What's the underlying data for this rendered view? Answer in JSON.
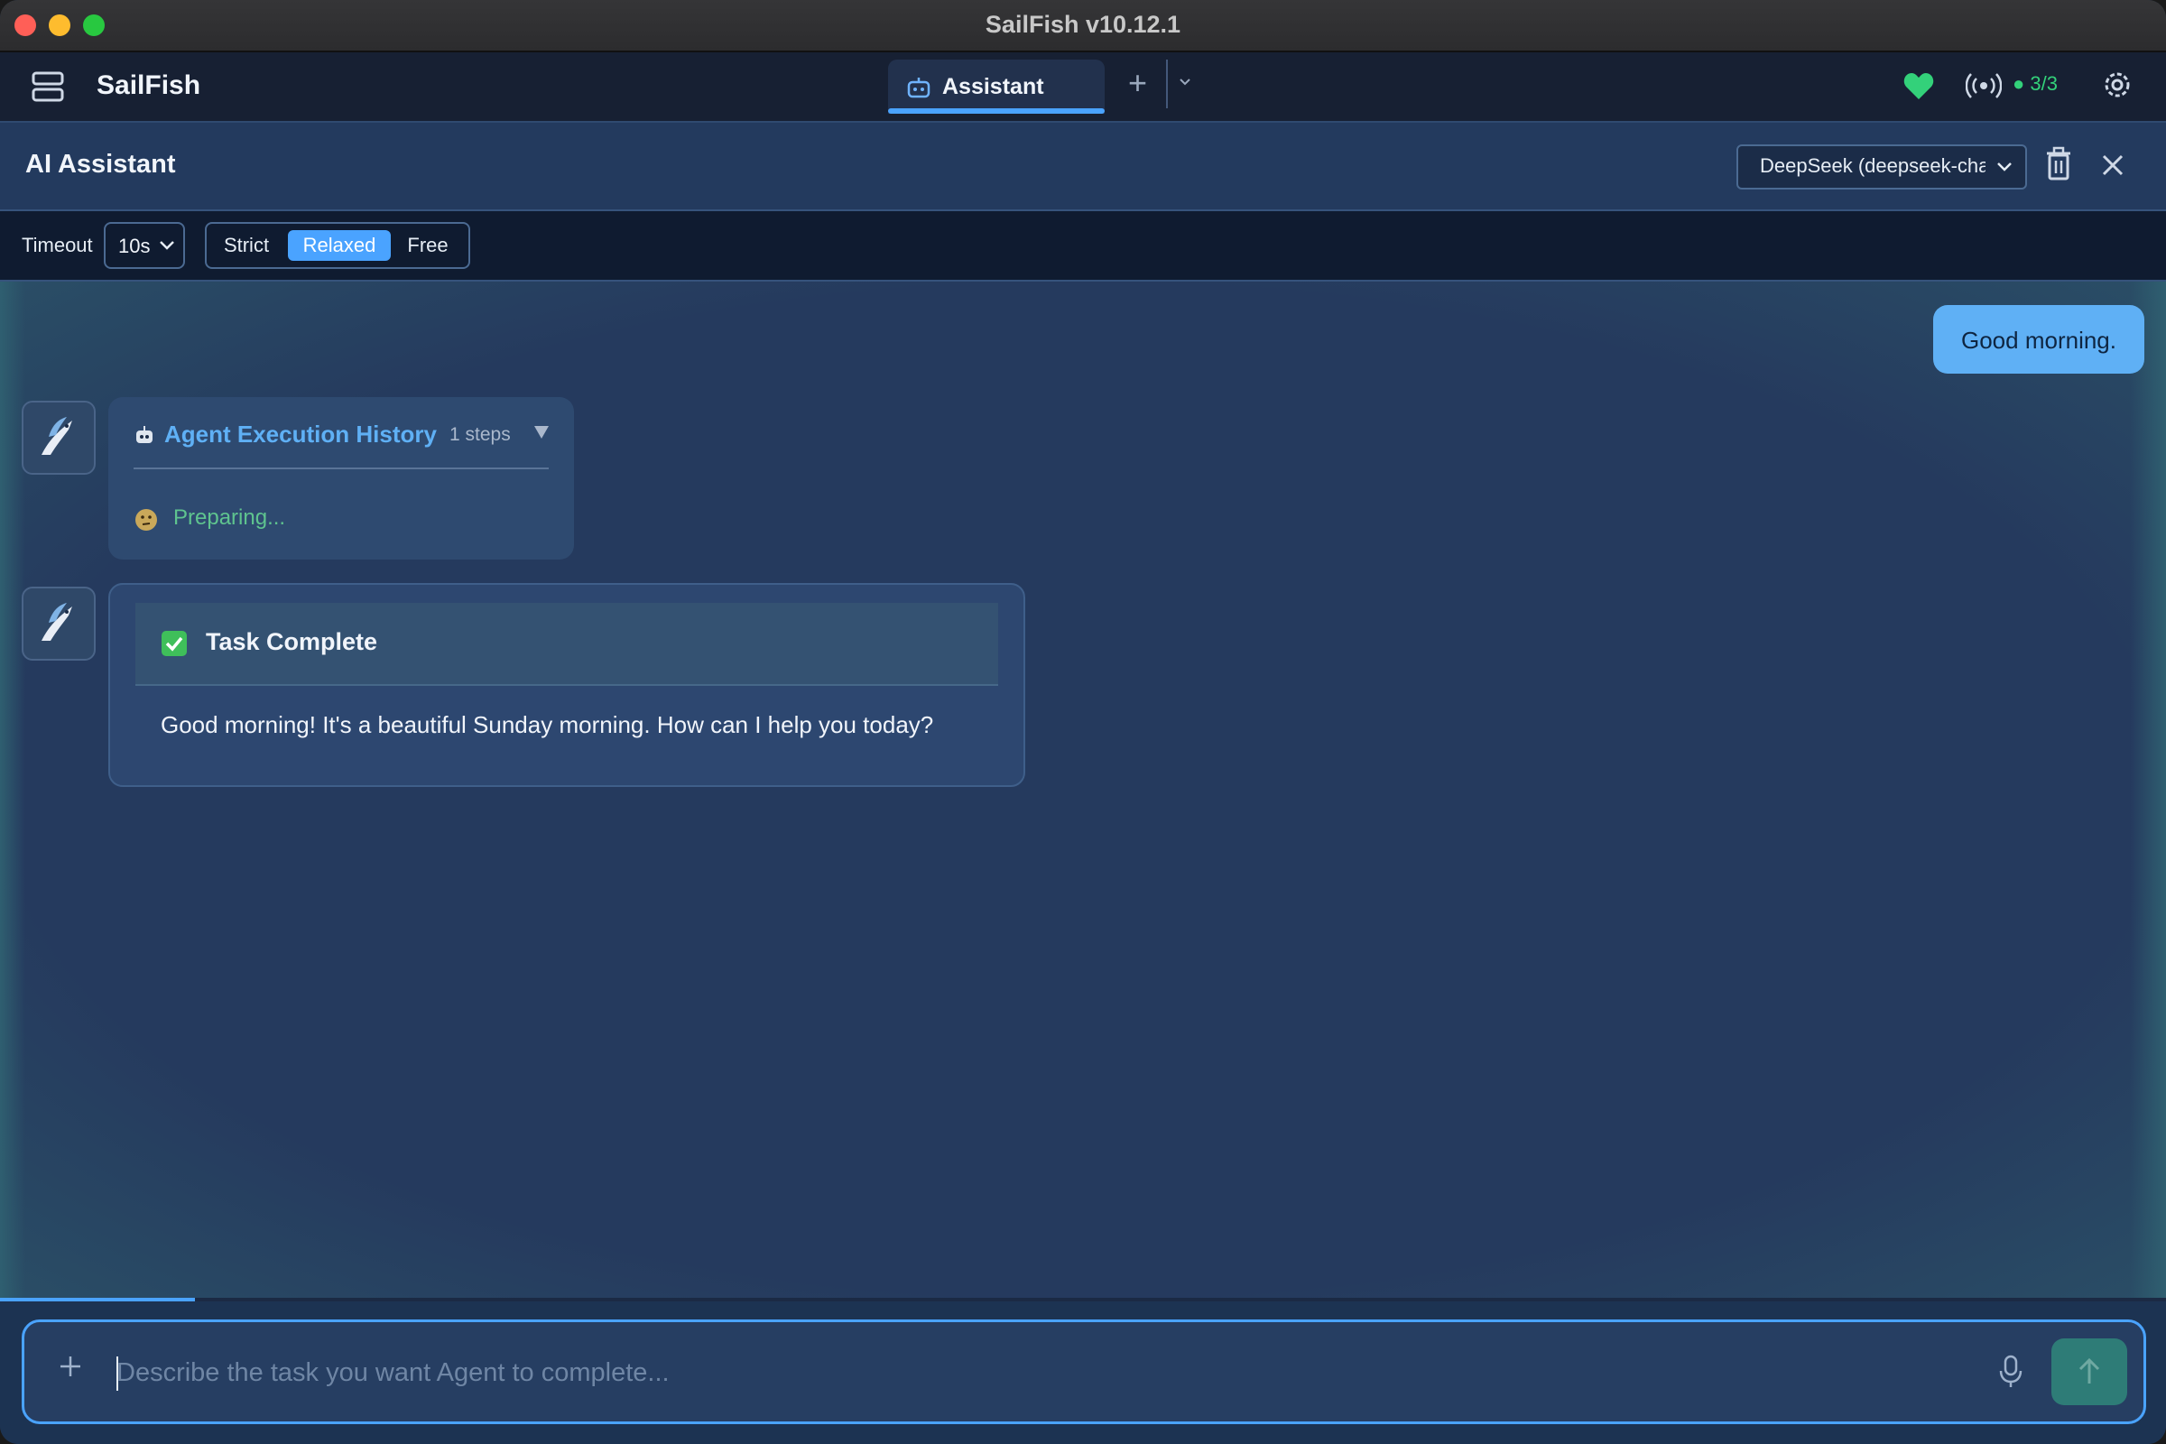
{
  "window": {
    "title": "SailFish v10.12.1"
  },
  "appbar": {
    "brand": "SailFish",
    "tabs": [
      {
        "label": "Assistant",
        "active": true
      }
    ],
    "connection_count": "3/3",
    "status_color": "#33d17a"
  },
  "assistant": {
    "title": "AI Assistant",
    "model_selected": "DeepSeek (deepseek-chat)"
  },
  "toolbar": {
    "timeout_label": "Timeout",
    "timeout_value": "10s",
    "modes": [
      "Strict",
      "Relaxed",
      "Free"
    ],
    "active_mode": "Relaxed"
  },
  "chat": {
    "user_message": "Good morning.",
    "history": {
      "title": "Agent Execution History",
      "steps": "1 steps",
      "status": "Preparing..."
    },
    "result": {
      "title": "Task Complete",
      "body": "Good morning! It's a beautiful Sunday morning. How can I help you today?"
    }
  },
  "progress": {
    "fraction": 0.09
  },
  "composer": {
    "placeholder": "Describe the task you want Agent to complete...",
    "value": ""
  },
  "colors": {
    "accent": "#4aa3ff",
    "user_bubble": "#5fb0f5",
    "status_green": "#5fc48f",
    "send_button": "#2e7c77"
  }
}
